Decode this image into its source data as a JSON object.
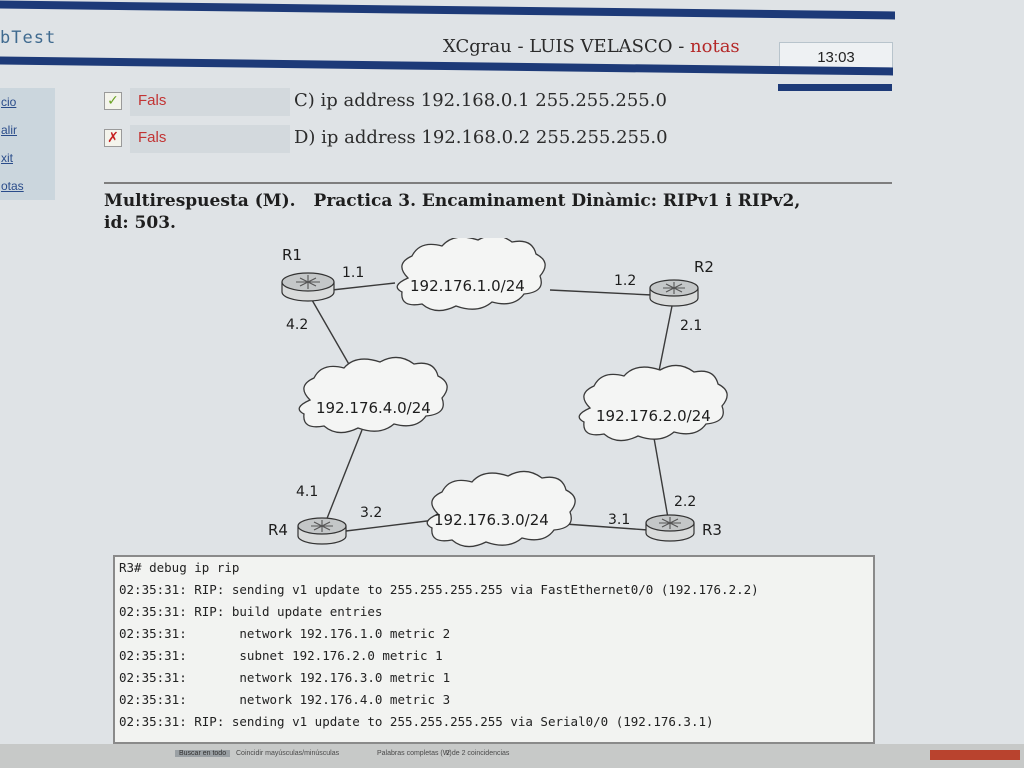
{
  "app": {
    "name": "bTest"
  },
  "header": {
    "title_main": "XCgrau - LUIS VELASCO - ",
    "title_accent": "notas",
    "clock": "13:03"
  },
  "sidebar": {
    "items": [
      {
        "label": "cio"
      },
      {
        "label": "alir"
      },
      {
        "label": "xit"
      },
      {
        "label": "otas"
      }
    ]
  },
  "answers": [
    {
      "status": "Fals",
      "mark": "✓",
      "text": "C) ip address 192.168.0.1 255.255.255.0"
    },
    {
      "status": "Fals",
      "mark": "✗",
      "text": "D) ip address 192.168.0.2 255.255.255.0"
    }
  ],
  "question": {
    "type": "Multirespuesta (M).",
    "practice": "Practica 3. Encaminament Dinàmic: RIPv1 i RIPv2,",
    "id": "id: 503."
  },
  "diagram": {
    "routers": {
      "r1": "R1",
      "r2": "R2",
      "r3": "R3",
      "r4": "R4"
    },
    "networks": {
      "n1": "192.176.1.0/24",
      "n2": "192.176.2.0/24",
      "n3": "192.176.3.0/24",
      "n4": "192.176.4.0/24"
    },
    "interfaces": {
      "r1_n1": "1.1",
      "r2_n1": "1.2",
      "r2_n2": "2.1",
      "r3_n2": "2.2",
      "r3_n3": "3.1",
      "r4_n3": "3.2",
      "r4_n4": "4.1",
      "r1_n4": "4.2"
    }
  },
  "console": {
    "lines": [
      "R3# debug ip rip",
      "02:35:31: RIP: sending v1 update to 255.255.255.255 via FastEthernet0/0 (192.176.2.2)",
      "02:35:31: RIP: build update entries",
      "02:35:31:       network 192.176.1.0 metric 2",
      "02:35:31:       subnet 192.176.2.0 metric 1",
      "02:35:31:       network 192.176.3.0 metric 1",
      "02:35:31:       network 192.176.4.0 metric 3",
      "02:35:31: RIP: sending v1 update to 255.255.255.255 via Serial0/0 (192.176.3.1)"
    ]
  },
  "taskbar": {
    "find_label": "Buscar en todo",
    "match_case": "Coincidir mayúsculas/minúsculas",
    "whole_words": "Palabras completas (W)",
    "matches": "2 de 2 coincidencias"
  }
}
